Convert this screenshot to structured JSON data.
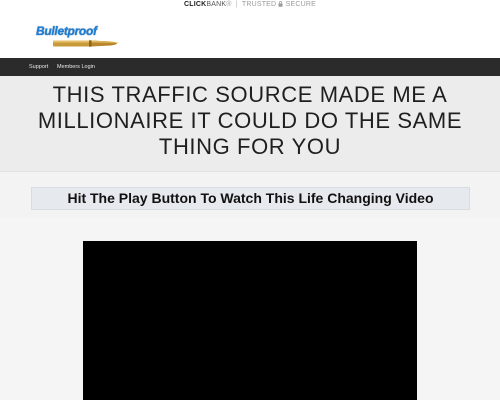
{
  "trust_badge": {
    "brand_click": "CLICK",
    "brand_bank": "BANK",
    "registered": "®",
    "separator": "|",
    "trusted": "TRUSTED",
    "lock_icon": "lock-icon",
    "secure": "SECURE"
  },
  "logo": {
    "text": "Bulletproof",
    "icon": "bullet-icon",
    "colors": {
      "text": "#1a7fd6",
      "bullet": "#b8862b"
    }
  },
  "nav": {
    "items": [
      {
        "label": "Support"
      },
      {
        "label": "Members Login"
      }
    ]
  },
  "hero": {
    "headline": "THIS TRAFFIC SOURCE MADE ME A MILLIONAIRE IT COULD DO THE SAME THING FOR YOU"
  },
  "video_section": {
    "subtitle": "Hit The Play Button To Watch This Life Changing Video"
  },
  "colors": {
    "nav_bg": "#2b2b2b",
    "hero_bg": "#ececec",
    "subtitle_bg": "#e6e9ed",
    "video_bg": "#000000"
  }
}
